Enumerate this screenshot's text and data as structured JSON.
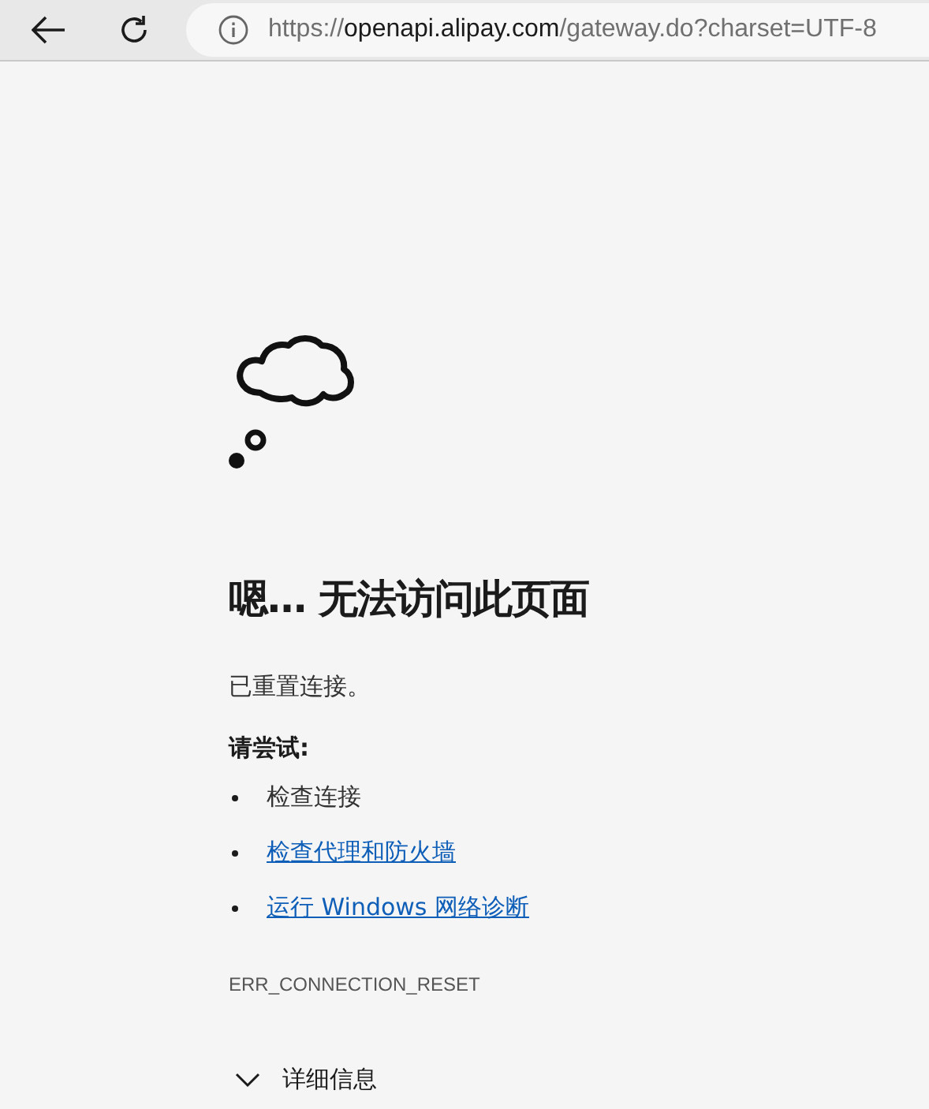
{
  "toolbar": {
    "address": {
      "scheme": "https://",
      "host": "openapi.alipay.com",
      "path": "/gateway.do?charset=UTF-8"
    }
  },
  "error": {
    "title": "嗯… 无法访问此页面",
    "message": "已重置连接。",
    "suggestions_heading": "请尝试:",
    "suggestions": [
      {
        "kind": "text",
        "label": "检查连接"
      },
      {
        "kind": "link",
        "label": "检查代理和防火墙"
      },
      {
        "kind": "link",
        "label": "运行 Windows 网络诊断"
      }
    ],
    "code": "ERR_CONNECTION_RESET",
    "details": {
      "label": "详细信息",
      "expanded": false
    }
  }
}
